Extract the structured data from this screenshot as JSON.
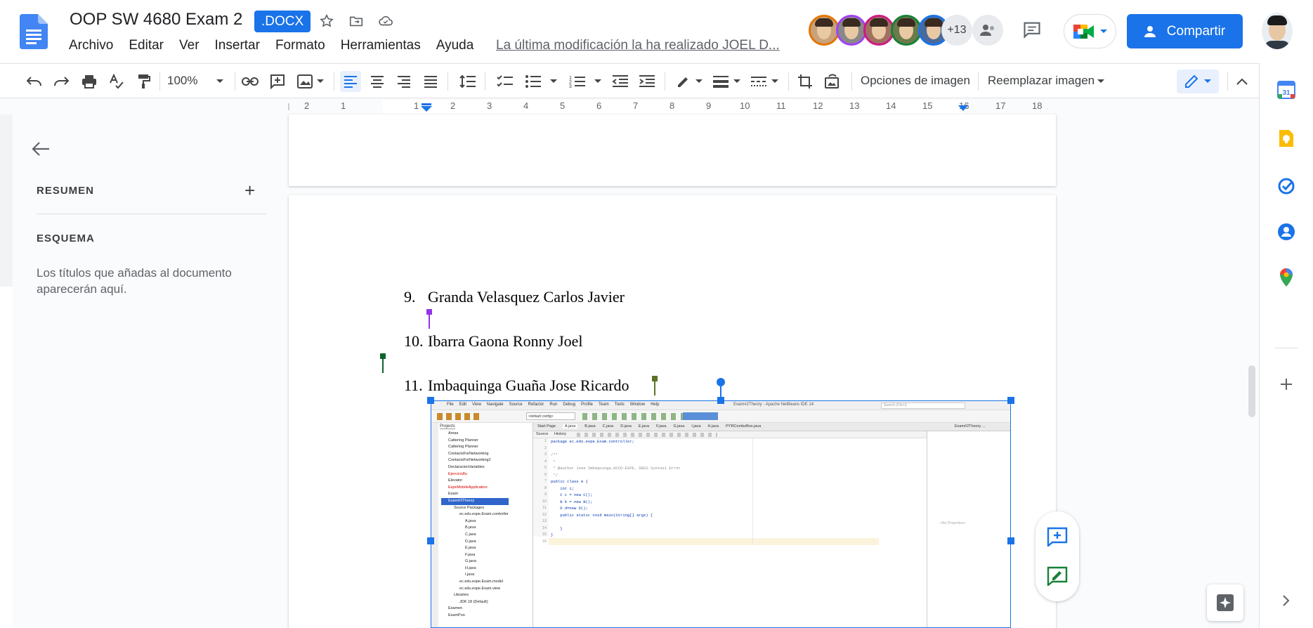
{
  "header": {
    "doc_title": "OOP SW 4680 Exam 2",
    "file_badge": ".DOCX",
    "menu": [
      "Archivo",
      "Editar",
      "Ver",
      "Insertar",
      "Formato",
      "Herramientas",
      "Ayuda"
    ],
    "last_edit": "La última modificación la ha realizado JOEL D...",
    "collaborators_more": "+13",
    "share_label": "Compartir"
  },
  "toolbar": {
    "zoom": "100%",
    "image_options": "Opciones de imagen",
    "replace_image": "Reemplazar imagen"
  },
  "ruler": {
    "numbers": [
      "2",
      "1",
      "1",
      "2",
      "3",
      "4",
      "5",
      "6",
      "7",
      "8",
      "9",
      "10",
      "11",
      "12",
      "13",
      "14",
      "15",
      "16",
      "17",
      "18"
    ]
  },
  "outline": {
    "summary_label": "RESUMEN",
    "summary_add": "+",
    "outline_label": "ESQUEMA",
    "hint": "Los títulos que añadas al documento aparecerán aquí."
  },
  "document": {
    "items": [
      {
        "num": "9.",
        "text": "Granda Velasquez Carlos Javier"
      },
      {
        "num": "10.",
        "text": "Ibarra Gaona Ronny Joel"
      },
      {
        "num": "11.",
        "text": "Imbaquinga Guaña Jose Ricardo"
      }
    ]
  },
  "embedded_ide": {
    "window_title": "Exam#2Theory - Apache NetBeans IDE 14",
    "menu": [
      "File",
      "Edit",
      "View",
      "Navigate",
      "Source",
      "Refactor",
      "Run",
      "Debug",
      "Profile",
      "Team",
      "Tools",
      "Window",
      "Help"
    ],
    "search_placeholder": "Search (Ctrl+I)",
    "config": "<default config>",
    "projects_tab": "Projects",
    "tabs": [
      "Start Page",
      "A.java",
      "B.java",
      "C.java",
      "D.java",
      "E.java",
      "F.java",
      "G.java",
      "I.java",
      "H.java",
      "PYRComboBox.java"
    ],
    "right_tab": "Exam#2Theory ...",
    "source_tab": "Source",
    "history_tab": "History",
    "tree": [
      "Areas",
      "Cattering Planner",
      "Cattering Planner",
      "ContactsForNetworking",
      "ContactsForNetworking2",
      "DeclaracionVariables",
      "Ejercicio8u",
      "Elevator",
      "EspeMobileApplication",
      "Exam",
      "Exam#2Theory",
      "Source Packages",
      "ec.edu.espe.Exam.controller",
      "A.java",
      "B.java",
      "C.java",
      "D.java",
      "E.java",
      "F.java",
      "G.java",
      "H.java",
      "I.java",
      "ec.edu.espe.Exam.model",
      "ec.edu.espe.Exam.view",
      "Libraries",
      "JDK 18 (Default)",
      "Examen",
      "ExamPoo"
    ],
    "line_numbers": [
      "1",
      "2",
      "3",
      "4",
      "5",
      "6",
      "7",
      "8",
      "9",
      "10",
      "11",
      "12",
      "13",
      "14",
      "15",
      "16"
    ],
    "code": [
      "package ec.edu.espe.Exam.controller;",
      "",
      "/**",
      " *",
      " * @author Jose Imbaquinga,DCCO-ESPE, DEES Syntaxi Error",
      " */",
      "public class A {",
      "    int i;",
      "    C c = new C();",
      "    B b = new B();",
      "    D d=new D();",
      "    public static void main(String[] args) {",
      "",
      "    }",
      "}",
      ""
    ],
    "no_properties": "<No Properties>"
  },
  "colors": {
    "accent": "#1a73e8",
    "avatar_borders": [
      "#e37400",
      "#a142f4",
      "#d01884",
      "#188038",
      "#1a73e8"
    ],
    "cursor_purple": "#9334e6",
    "cursor_green": "#0d652d",
    "cursor_olive": "#5b7324"
  },
  "icons": {
    "side_panel": [
      "calendar-icon",
      "keep-icon",
      "tasks-icon",
      "contacts-icon",
      "maps-icon",
      "add-icon",
      "chevron-right-icon"
    ]
  }
}
